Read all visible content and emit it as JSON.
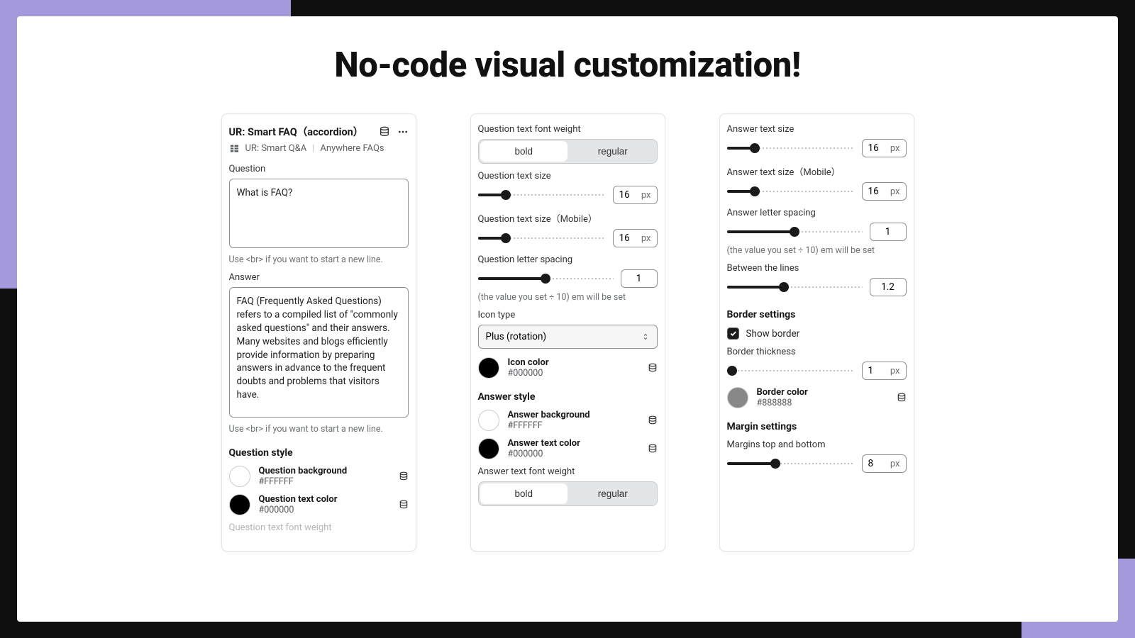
{
  "headline": "No-code visual customization!",
  "panel1": {
    "title": "UR: Smart FAQ（accordion）",
    "breadcrumb_app": "UR: Smart Q&A",
    "breadcrumb_section": "Anywhere FAQs",
    "question_label": "Question",
    "question_value": "What is FAQ?",
    "question_hint": "Use <br> if you want to start a new line.",
    "answer_label": "Answer",
    "answer_value": "FAQ (Frequently Asked Questions) refers to a compiled list of \"commonly asked questions\" and their answers. Many websites and blogs efficiently provide information by preparing answers in advance to the frequent doubts and problems that visitors have.",
    "answer_hint": "Use <br> if you want to start a new line.",
    "question_style_heading": "Question style",
    "qbg_label": "Question background",
    "qbg_hex": "#FFFFFF",
    "qtc_label": "Question text color",
    "qtc_hex": "#000000",
    "faded": "Question text font weight"
  },
  "panel2": {
    "qfw_label": "Question text font weight",
    "bold": "bold",
    "regular": "regular",
    "qts_label": "Question text size",
    "qts_val": "16",
    "qts_unit": "px",
    "qtsm_label": "Question text size（Mobile）",
    "qtsm_val": "16",
    "qtsm_unit": "px",
    "qls_label": "Question letter spacing",
    "qls_val": "1",
    "qls_hint": "(the value you set ÷ 10) em will be set",
    "icon_type_label": "Icon type",
    "icon_type_value": "Plus (rotation)",
    "icon_color_label": "Icon color",
    "icon_color_hex": "#000000",
    "answer_style_heading": "Answer style",
    "abg_label": "Answer background",
    "abg_hex": "#FFFFFF",
    "atc_label": "Answer text color",
    "atc_hex": "#000000",
    "afw_label": "Answer text font weight"
  },
  "panel3": {
    "ats_label": "Answer text size",
    "ats_val": "16",
    "ats_unit": "px",
    "atsm_label": "Answer text size（Mobile）",
    "atsm_val": "16",
    "atsm_unit": "px",
    "als_label": "Answer letter spacing",
    "als_val": "1",
    "als_hint": "(the value you set ÷ 10) em will be set",
    "btl_label": "Between the lines",
    "btl_val": "1.2",
    "border_heading": "Border settings",
    "show_border_label": "Show border",
    "bt_label": "Border thickness",
    "bt_val": "1",
    "bt_unit": "px",
    "bc_label": "Border color",
    "bc_hex": "#888888",
    "margin_heading": "Margin settings",
    "mtb_label": "Margins top and bottom",
    "mtb_val": "8",
    "mtb_unit": "px"
  }
}
